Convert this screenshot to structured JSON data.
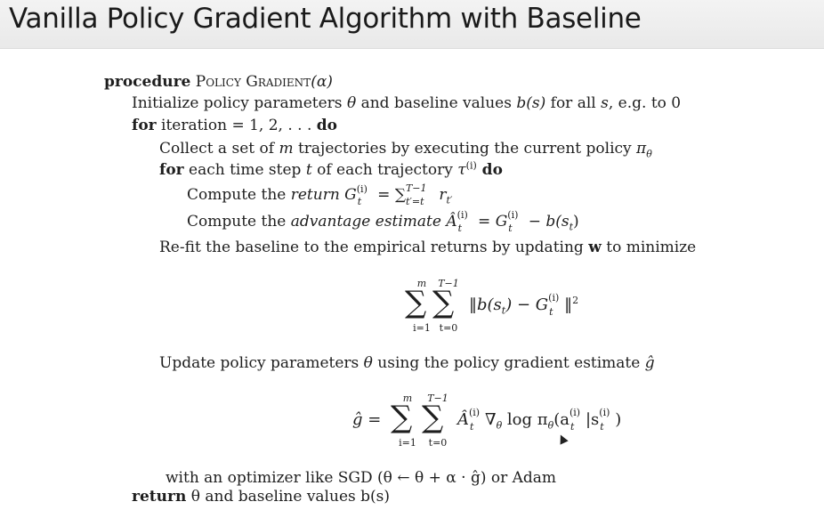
{
  "title": "Vanilla Policy Gradient Algorithm with Baseline",
  "algorithm": {
    "kw_procedure": "procedure",
    "proc_name": "Policy Gradient",
    "proc_arg": "(α)",
    "init_a": "Initialize policy parameters ",
    "init_theta": "θ",
    "init_b": " and baseline values ",
    "init_bs": "b(s)",
    "init_c": " for all ",
    "init_s": "s",
    "init_d": ", e.g. to 0",
    "kw_for": "for",
    "for_text": " iteration = 1, 2, . . . ",
    "kw_do": "do",
    "collect_a": "Collect a set of ",
    "collect_m": "m",
    "collect_b": " trajectories by executing the current policy ",
    "collect_pi": "π",
    "collect_sub": "θ",
    "for2_kw": "for",
    "for2_a": " each time step ",
    "for2_t": "t",
    "for2_b": " of each trajectory ",
    "for2_tau": "τ",
    "for2_sup": "(i)",
    "for2_do": " do",
    "ret_a": "Compute the ",
    "ret_b": "return",
    "ret_c": " G",
    "ret_sup": "(i)",
    "ret_sub": "t",
    "ret_d": " = ∑",
    "ret_sum_sup": "T−1",
    "ret_sum_sub": "t′=t",
    "ret_e": " r",
    "ret_e_sub": "t′",
    "adv_a": "Compute the ",
    "adv_b": "advantage estimate",
    "adv_c": " Â",
    "adv_sup": "(i)",
    "adv_sub": "t",
    "adv_d": " = G",
    "adv_sup2": "(i)",
    "adv_sub2": "t",
    "adv_e": " − b(s",
    "adv_e_sub": "t",
    "adv_f": ")",
    "refit_a": "Re-fit the baseline to the empirical returns by updating ",
    "refit_w": "w",
    "refit_b": " to minimize",
    "update_a": "Update policy parameters ",
    "update_theta": "θ",
    "update_b": " using the policy gradient estimate ",
    "update_g": "ĝ",
    "opt_text": "with an optimizer like SGD (θ ← θ + α · ĝ) or Adam",
    "kw_return": "return",
    "ret_final": " θ and baseline values b(s)"
  },
  "eq1": {
    "sum1_top": "m",
    "sum1_bot": "i=1",
    "sum2_top": "T−1",
    "sum2_bot": "t=0",
    "sigma": "∑",
    "body": "‖b(s",
    "body_sub": "t",
    "body2": ") − G",
    "body_sup": "(i)",
    "body_sub2": "t",
    "body3": "‖",
    "body_sq": "2"
  },
  "eq2": {
    "lhs": "ĝ = ",
    "sum1_top": "m",
    "sum1_bot": "i=1",
    "sum2_top": "T−1",
    "sum2_bot": "t=0",
    "sigma": "∑",
    "a": "Â",
    "a_sup": "(i)",
    "a_sub": "t",
    "nabla": "∇",
    "nabla_sub": "θ",
    "log": " log π",
    "pi_sub": "θ",
    "paren": "(a",
    "a2_sup": "(i)",
    "a2_sub": "t",
    "bar": "|s",
    "s_sup": "(i)",
    "s_sub": "t",
    "close": ")"
  }
}
